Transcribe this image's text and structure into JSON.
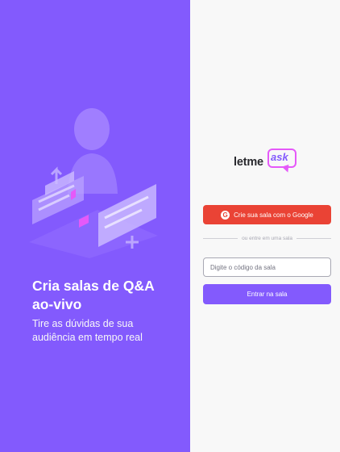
{
  "aside": {
    "title": "Cria salas de Q&A ao-vivo",
    "subtitle": "Tire as dúvidas de sua audiência em tempo real"
  },
  "logo": {
    "part1": "letme",
    "part2": "ask"
  },
  "google_button": {
    "label": "Crie sua sala com o Google",
    "icon": "google-icon"
  },
  "separator": {
    "text": "ou entre em uma sala"
  },
  "room_input": {
    "placeholder": "Digite o código da sala",
    "value": ""
  },
  "enter_button": {
    "label": "Entrar na sala"
  },
  "colors": {
    "purple": "#835afd",
    "google_red": "#ea4335",
    "pink": "#e559f9",
    "background": "#f8f8f8"
  }
}
